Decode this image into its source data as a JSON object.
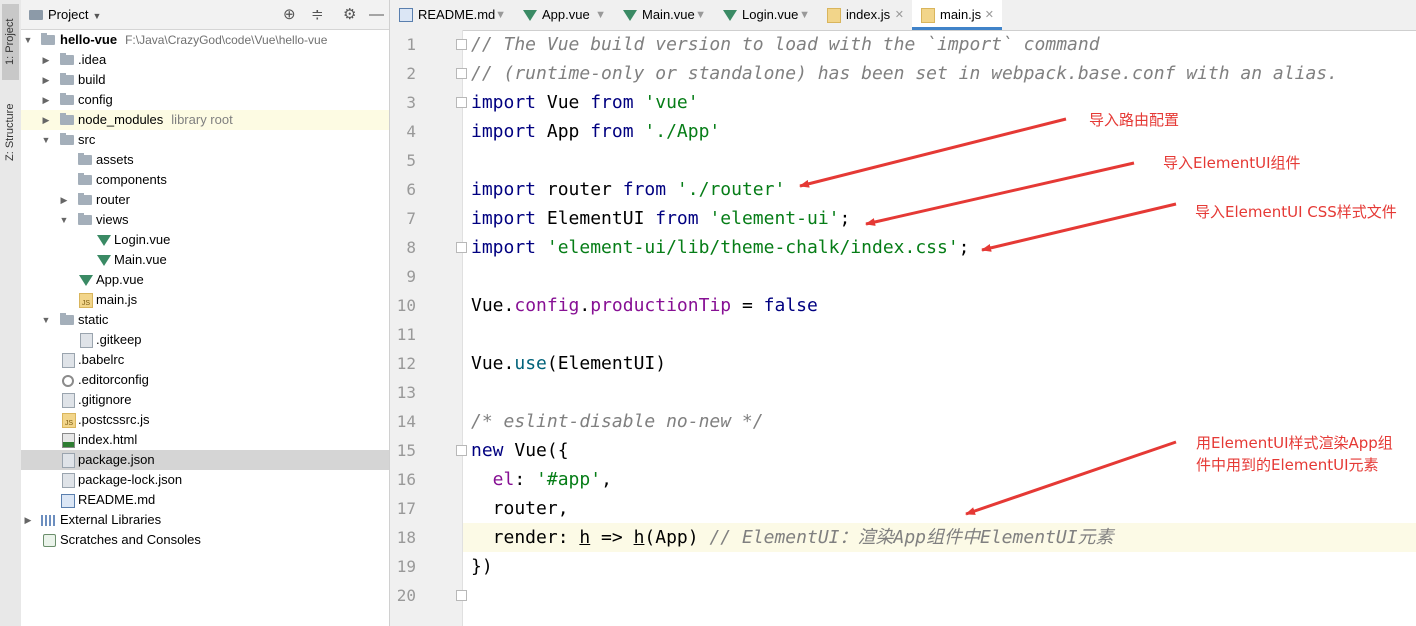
{
  "toolstrip": {
    "project_tab": "1: Project",
    "structure_tab": "Z: Structure"
  },
  "project_panel": {
    "title": "Project",
    "tree": [
      {
        "label": "hello-vue",
        "path": "F:\\Java\\CrazyGod\\code\\Vue\\hello-vue"
      },
      {
        "label": ".idea"
      },
      {
        "label": "build"
      },
      {
        "label": "config"
      },
      {
        "label": "node_modules",
        "hint": "library root"
      },
      {
        "label": "src"
      },
      {
        "label": "assets"
      },
      {
        "label": "components"
      },
      {
        "label": "router"
      },
      {
        "label": "views"
      },
      {
        "label": "Login.vue"
      },
      {
        "label": "Main.vue"
      },
      {
        "label": "App.vue"
      },
      {
        "label": "main.js"
      },
      {
        "label": "static"
      },
      {
        "label": ".gitkeep"
      },
      {
        "label": ".babelrc"
      },
      {
        "label": ".editorconfig"
      },
      {
        "label": ".gitignore"
      },
      {
        "label": ".postcssrc.js"
      },
      {
        "label": "index.html"
      },
      {
        "label": "package.json"
      },
      {
        "label": "package-lock.json"
      },
      {
        "label": "README.md"
      },
      {
        "label": "External Libraries"
      },
      {
        "label": "Scratches and Consoles"
      }
    ]
  },
  "tabs": [
    {
      "label": "README.md",
      "icon": "markdown-file-icon"
    },
    {
      "label": "App.vue",
      "icon": "vue-file-icon"
    },
    {
      "label": "Main.vue",
      "icon": "vue-file-icon"
    },
    {
      "label": "Login.vue",
      "icon": "vue-file-icon"
    },
    {
      "label": "index.js",
      "icon": "js-file-icon"
    },
    {
      "label": "main.js",
      "icon": "js-file-icon",
      "active": true
    }
  ],
  "line_numbers": [
    "1",
    "2",
    "3",
    "4",
    "5",
    "6",
    "7",
    "8",
    "9",
    "10",
    "11",
    "12",
    "13",
    "14",
    "15",
    "16",
    "17",
    "18",
    "19",
    "20"
  ],
  "code": {
    "l1": "// The Vue build version to load with the `import` command",
    "l2": "// (runtime-only or standalone) has been set in webpack.base.conf with an alias.",
    "l3": {
      "kw": "import",
      "a": " Vue ",
      "kw2": "from",
      "str": " 'vue'"
    },
    "l4": {
      "kw": "import",
      "a": " App ",
      "kw2": "from",
      "str": " './App'"
    },
    "l6": {
      "kw": "import",
      "a": " router ",
      "kw2": "from",
      "str": " './router'"
    },
    "l7": {
      "kw": "import",
      "a": " ElementUI ",
      "kw2": "from",
      "str": " 'element-ui'",
      "end": ";"
    },
    "l8": {
      "kw": "import",
      "str": " 'element-ui/lib/theme-chalk/index.css'",
      "end": ";"
    },
    "l10": {
      "a": "Vue.",
      "prop": "config",
      "b": ".",
      "prop2": "productionTip",
      "c": " = ",
      "kw": "false"
    },
    "l12": {
      "a": "Vue.",
      "fn": "use",
      "b": "(ElementUI)"
    },
    "l14": "/* eslint-disable no-new */",
    "l15": {
      "kw": "new",
      "a": " Vue({"
    },
    "l16": {
      "prop": "  el",
      "a": ": ",
      "str": "'#app'",
      "b": ","
    },
    "l17": "  router,",
    "l18": {
      "a": "  render: ",
      "h1": "h",
      "b": " => ",
      "h2": "h",
      "c": "(App) ",
      "cm": "// ElementUI：渲染App组件中ElementUI元素"
    },
    "l19": "})"
  },
  "annotations": {
    "a1": "导入路由配置",
    "a2": "导入ElementUI组件",
    "a3": "导入ElementUI CSS样式文件",
    "a4_line1": "用ElementUI样式渲染App组",
    "a4_line2": "件中用到的ElementUI元素"
  },
  "colors": {
    "annotation": "#e53935",
    "keyword": "#000080",
    "string": "#067d17",
    "comment": "#808080"
  }
}
